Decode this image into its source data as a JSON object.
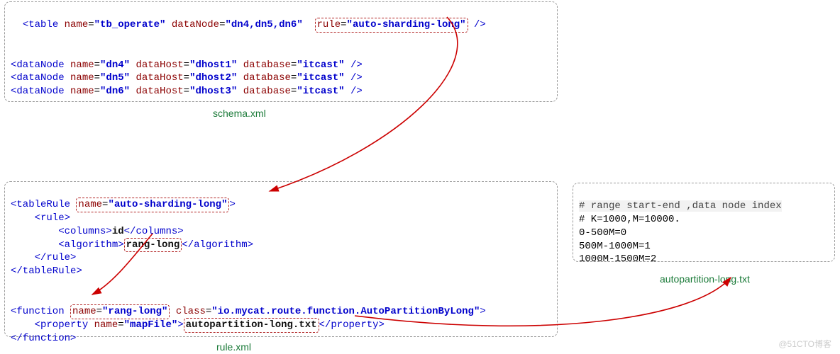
{
  "schema_panel": {
    "caption": "schema.xml",
    "table_tag_open": "<table ",
    "table_name_attr": "name",
    "table_name_val": "\"tb_operate\"",
    "dataNode_attr": "dataNode",
    "dataNode_val": "\"dn4,dn5,dn6\"",
    "rule_attr": "rule",
    "rule_val": "\"auto-sharding-long\"",
    "tag_selfclose": " />",
    "dn_rows": [
      {
        "tag": "<dataNode ",
        "name_attr": "name",
        "name_val": "\"dn4\"",
        "host_attr": "dataHost",
        "host_val": "\"dhost1\"",
        "db_attr": "database",
        "db_val": "\"itcast\"",
        "close": " />"
      },
      {
        "tag": "<dataNode ",
        "name_attr": "name",
        "name_val": "\"dn5\"",
        "host_attr": "dataHost",
        "host_val": "\"dhost2\"",
        "db_attr": "database",
        "db_val": "\"itcast\"",
        "close": " />"
      },
      {
        "tag": "<dataNode ",
        "name_attr": "name",
        "name_val": "\"dn6\"",
        "host_attr": "dataHost",
        "host_val": "\"dhost3\"",
        "db_attr": "database",
        "db_val": "\"itcast\"",
        "close": " />"
      }
    ]
  },
  "rule_panel": {
    "caption": "rule.xml",
    "tableRule_open": "<tableRule ",
    "name_attr": "name",
    "tableRule_name_val": "\"auto-sharding-long\"",
    "close_gt": ">",
    "rule_open": "    <rule>",
    "columns_open": "        <columns>",
    "columns_text": "id",
    "columns_close": "</columns>",
    "algorithm_open": "        <algorithm>",
    "algorithm_text": "rang-long",
    "algorithm_close": "</algorithm>",
    "rule_close": "    </rule>",
    "tableRule_close": "</tableRule>",
    "function_open": "<function ",
    "function_name_val": "\"rang-long\"",
    "class_attr": "class",
    "class_val": "\"io.mycat.route.function.AutoPartitionByLong\"",
    "property_open": "    <property ",
    "property_name_attr": "name",
    "property_name_val": "\"mapFile\"",
    "property_text": "autopartition-long.txt",
    "property_close": "</property>",
    "function_close": "</function>"
  },
  "autopartition_panel": {
    "caption": "autopartition-long.txt",
    "line1_a": "# range start-end ,",
    "line1_b": "data node index",
    "line2": "# K=1000,M=10000.",
    "line3": "0-500M=0",
    "line4": "500M-1000M=1",
    "line5": "1000M-1500M=2"
  },
  "watermark": "@51CTO博客"
}
